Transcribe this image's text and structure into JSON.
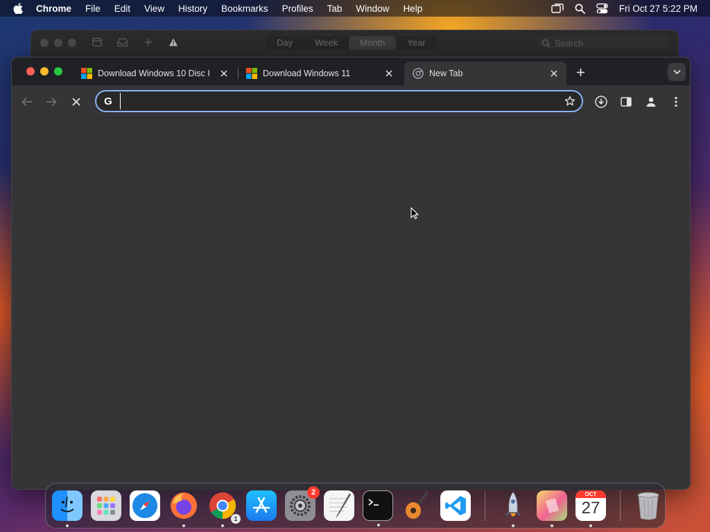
{
  "menubar": {
    "app_name": "Chrome",
    "items": [
      "File",
      "Edit",
      "View",
      "History",
      "Bookmarks",
      "Profiles",
      "Tab",
      "Window",
      "Help"
    ],
    "clock": "Fri Oct 27  5:22 PM"
  },
  "calendar_window": {
    "views": [
      "Day",
      "Week",
      "Month",
      "Year"
    ],
    "selected_view": "Month",
    "search_placeholder": "Search"
  },
  "browser": {
    "tabs": [
      {
        "title": "Download Windows 10 Disc I",
        "favicon": "windows-logo-icon",
        "active": false
      },
      {
        "title": "Download Windows 11",
        "favicon": "windows-logo-icon",
        "active": false
      },
      {
        "title": "New Tab",
        "favicon": "chrome-logo-icon",
        "active": true
      }
    ],
    "omnibox": {
      "value": "",
      "placeholder": ""
    }
  },
  "dock": {
    "items": [
      {
        "name": "finder",
        "running": true
      },
      {
        "name": "launchpad",
        "running": false
      },
      {
        "name": "safari",
        "running": false
      },
      {
        "name": "firefox",
        "running": true
      },
      {
        "name": "chrome",
        "running": true,
        "badge": "1"
      },
      {
        "name": "app-store",
        "running": false
      },
      {
        "name": "system-settings",
        "running": false,
        "badge": "2"
      },
      {
        "name": "textedit",
        "running": false
      },
      {
        "name": "terminal",
        "running": true
      },
      {
        "name": "garageband",
        "running": false
      },
      {
        "name": "vscode",
        "running": false
      },
      {
        "name": "rocket",
        "running": true
      },
      {
        "name": "notes-app",
        "running": true
      },
      {
        "name": "calendar",
        "running": true,
        "month": "OCT",
        "day": "27"
      },
      {
        "name": "trash",
        "running": false
      }
    ]
  },
  "colors": {
    "accent": "#8ab4f8",
    "window_bg": "#353537",
    "tabstrip_bg": "#202124",
    "close_red": "#ff5f57",
    "minimize_yellow": "#febc2e",
    "zoom_green": "#28c840"
  }
}
